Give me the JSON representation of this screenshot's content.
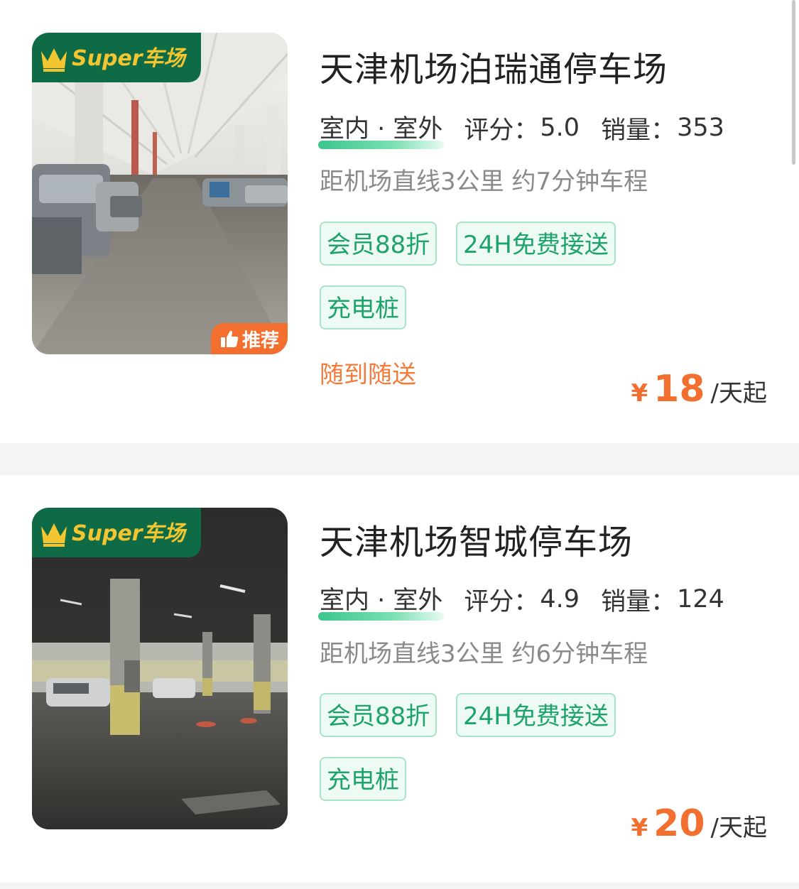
{
  "lots": [
    {
      "title": "天津机场泊瑞通停车场",
      "super_badge": "Super车场",
      "type_label": "室内 · 室外",
      "rating_label": "评分：",
      "rating": "5.0",
      "sales_label": "销量：",
      "sales": "353",
      "distance": "距机场直线3公里 约7分钟车程",
      "tags": [
        "会员88折",
        "24H免费接送",
        "充电桩"
      ],
      "recommend_badge": "推荐",
      "note": "随到随送",
      "price_currency": "¥",
      "price": "18",
      "price_unit": "/天起"
    },
    {
      "title": "天津机场智城停车场",
      "super_badge": "Super车场",
      "type_label": "室内 · 室外",
      "rating_label": "评分：",
      "rating": "4.9",
      "sales_label": "销量：",
      "sales": "124",
      "distance": "距机场直线3公里 约6分钟车程",
      "tags": [
        "会员88折",
        "24H免费接送",
        "充电桩"
      ],
      "price_currency": "¥",
      "price": "20",
      "price_unit": "/天起"
    }
  ],
  "colors": {
    "brand_green": "#0f6b45",
    "tag_green": "#1fa36c",
    "accent_orange": "#f36f2f",
    "gold": "#f2c531"
  },
  "icons": {
    "crown": "crown-icon",
    "thumb_up": "thumb-up-icon"
  }
}
